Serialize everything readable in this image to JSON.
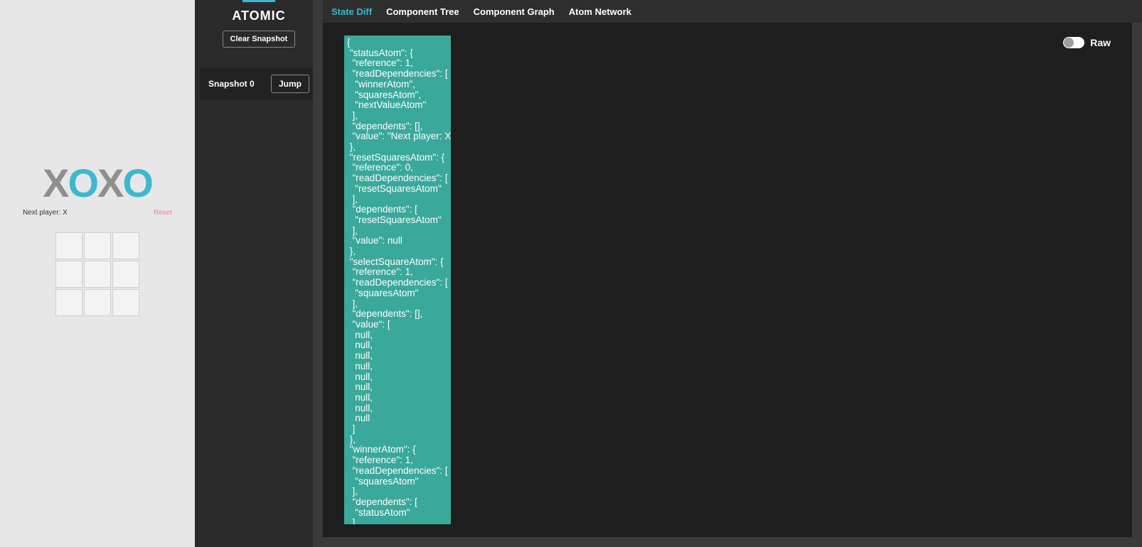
{
  "leftPanel": {
    "logoLetters": [
      "X",
      "O",
      "X",
      "O"
    ],
    "statusText": "Next player: X",
    "resetLabel": "Reset"
  },
  "sidebar": {
    "title": "ATOMIC",
    "clearLabel": "Clear Snapshot",
    "snapshots": [
      {
        "label": "Snapshot 0",
        "jumpLabel": "Jump"
      }
    ]
  },
  "devtools": {
    "tabs": [
      {
        "label": "State Diff",
        "active": true
      },
      {
        "label": "Component Tree",
        "active": false
      },
      {
        "label": "Component Graph",
        "active": false
      },
      {
        "label": "Atom Network",
        "active": false
      }
    ],
    "rawLabel": "Raw",
    "stateJson": "{\n \"statusAtom\": {\n  \"reference\": 1,\n  \"readDependencies\": [\n   \"winnerAtom\",\n   \"squaresAtom\",\n   \"nextValueAtom\"\n  ],\n  \"dependents\": [],\n  \"value\": \"Next player: X\"\n },\n \"resetSquaresAtom\": {\n  \"reference\": 0,\n  \"readDependencies\": [\n   \"resetSquaresAtom\"\n  ],\n  \"dependents\": [\n   \"resetSquaresAtom\"\n  ],\n  \"value\": null\n },\n \"selectSquareAtom\": {\n  \"reference\": 1,\n  \"readDependencies\": [\n   \"squaresAtom\"\n  ],\n  \"dependents\": [],\n  \"value\": [\n   null,\n   null,\n   null,\n   null,\n   null,\n   null,\n   null,\n   null,\n   null\n  ]\n },\n \"winnerAtom\": {\n  \"reference\": 1,\n  \"readDependencies\": [\n   \"squaresAtom\"\n  ],\n  \"dependents\": [\n   \"statusAtom\"\n  ],\n  \"value\": null"
  }
}
